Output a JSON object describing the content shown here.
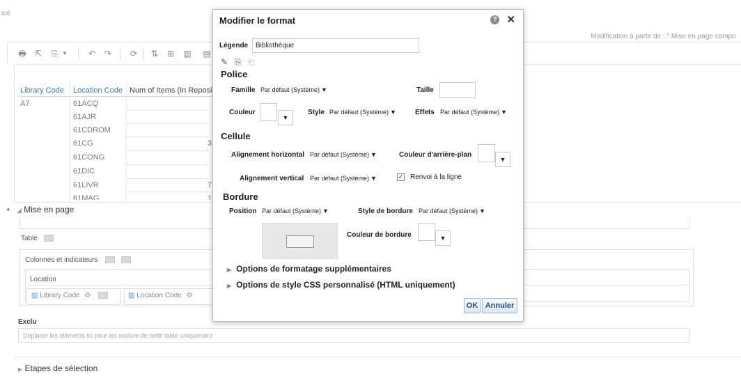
{
  "background": {
    "corner_text": "icé",
    "modification_text": "Modification à partir de : \" Mise en page compo",
    "table": {
      "headers": [
        "Library Code",
        "Location Code",
        "Num of Items (In Reposit"
      ],
      "library_value": "A7",
      "location_codes": [
        "61ACQ",
        "61AJR",
        "61CDROM",
        "61CG",
        "61CONG",
        "61DIC",
        "61LIVR",
        "61MAG"
      ],
      "partial_values": [
        "3",
        "7",
        "1"
      ]
    },
    "mise_en_page": "Mise en page",
    "table_label": "Table",
    "colonnes_label": "Colonnes et indicateurs",
    "location_label": "Location",
    "library_code_chip": "Library Code",
    "location_code_chip": "Location Code",
    "exclu_label": "Exclu",
    "exclu_placeholder": "Déplacer les éléments ici pour les exclure de cette table uniquement",
    "etapes_label": "Etapes de sélection"
  },
  "dialog": {
    "title": "Modifier le format",
    "legende_label": "Légende",
    "legende_value": "Bibliothèque",
    "police_heading": "Police",
    "famille_label": "Famille",
    "famille_value": "Par défaut (Système)",
    "taille_label": "Taille",
    "taille_value": "",
    "couleur_label": "Couleur",
    "style_label": "Style",
    "style_value": "Par défaut (Système)",
    "effets_label": "Effets",
    "effets_value": "Par défaut (Système)",
    "cellule_heading": "Cellule",
    "align_h_label": "Alignement horizontal",
    "align_h_value": "Par défaut (Système)",
    "bg_color_label": "Couleur d'arrière-plan",
    "align_v_label": "Alignement vertical",
    "align_v_value": "Par défaut (Système)",
    "wrap_label": "Renvoi à la ligne",
    "wrap_checked": true,
    "bordure_heading": "Bordure",
    "position_label": "Position",
    "position_value": "Par défaut (Système)",
    "border_style_label": "Style de bordure",
    "border_style_value": "Par défaut (Système)",
    "border_color_label": "Couleur de bordure",
    "options_format": "Options de formatage supplémentaires",
    "options_css": "Options de style CSS personnalisé (HTML uniquement)",
    "ok_label": "OK",
    "cancel_label": "Annuler"
  }
}
